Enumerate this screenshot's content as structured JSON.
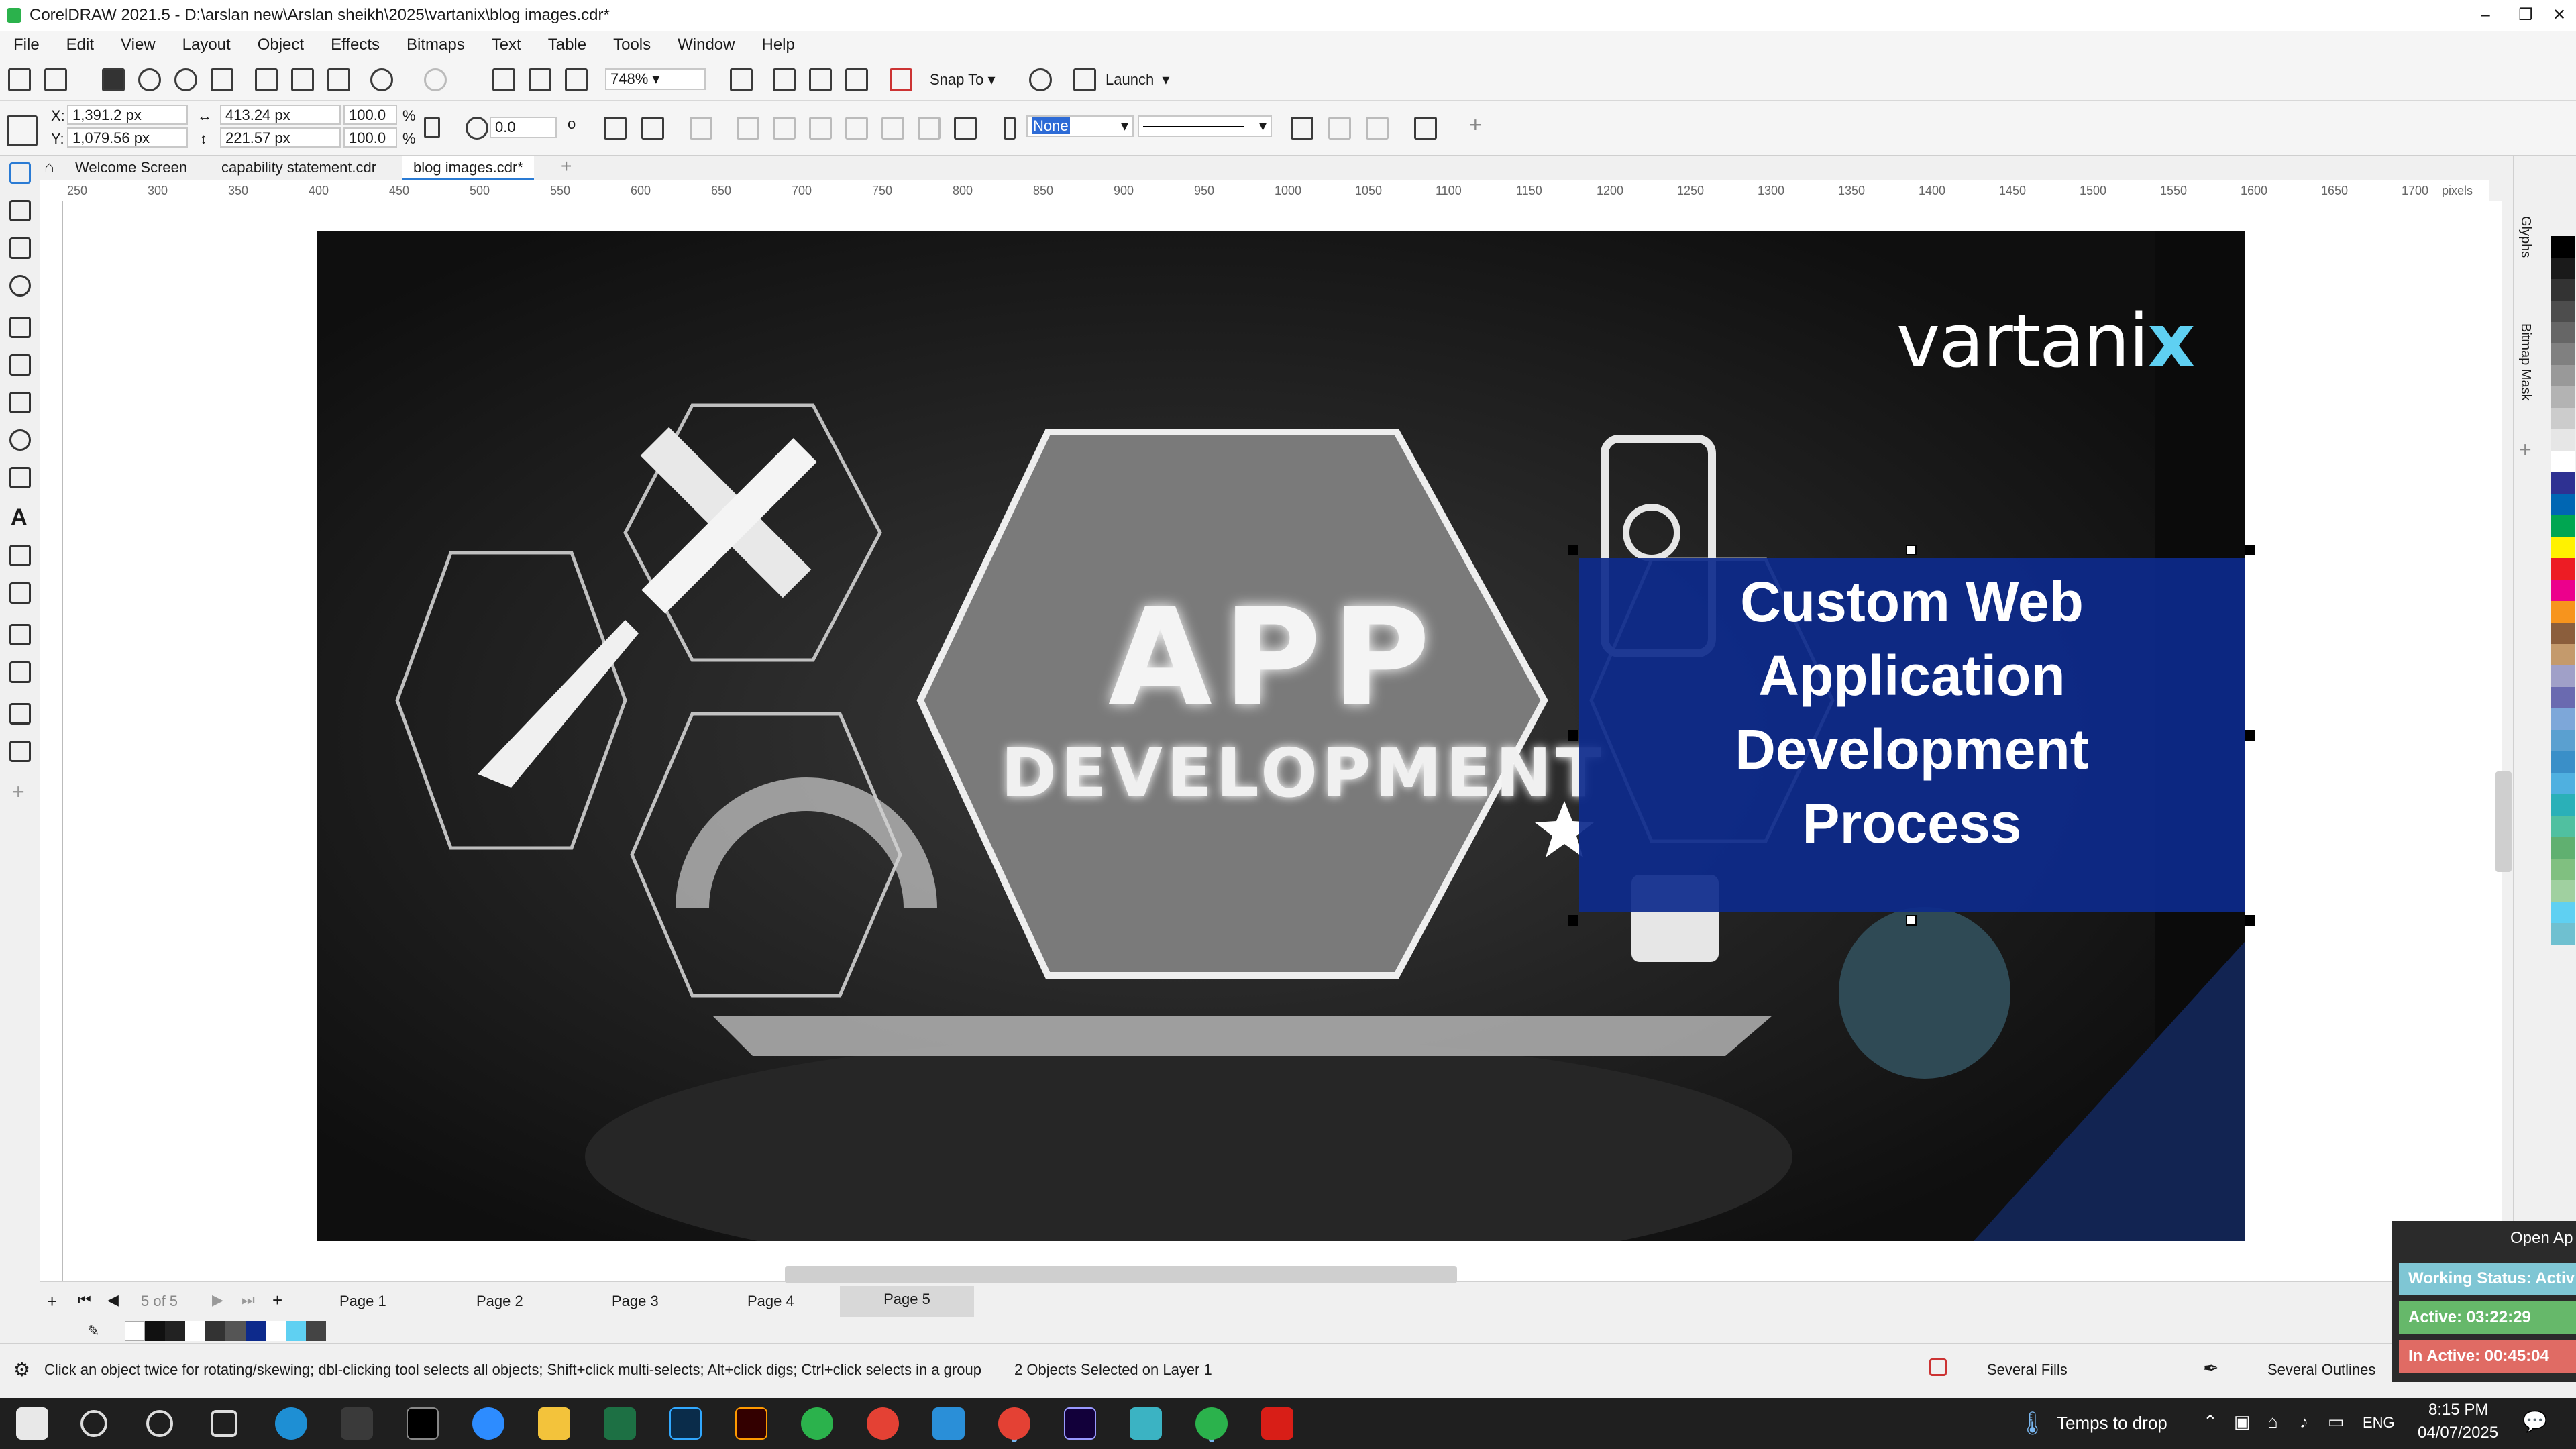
{
  "window": {
    "title": "CorelDRAW 2021.5 - D:\\arslan new\\Arslan sheikh\\2025\\vartanix\\blog images.cdr*"
  },
  "menu": [
    "File",
    "Edit",
    "View",
    "Layout",
    "Object",
    "Effects",
    "Bitmaps",
    "Text",
    "Table",
    "Tools",
    "Window",
    "Help"
  ],
  "toolbar": {
    "zoom": "748%",
    "snap_to": "Snap To",
    "launch": "Launch"
  },
  "property_bar": {
    "x": "1,391.2 px",
    "y": "1,079.56 px",
    "width": "413.24 px",
    "height": "221.57 px",
    "scale_w": "100.0",
    "scale_h": "100.0",
    "percent": "%",
    "rotation": "0.0",
    "outline": "None"
  },
  "doc_tabs": [
    "Welcome Screen",
    "capability statement.cdr",
    "blog images.cdr*"
  ],
  "ruler_labels": [
    "250",
    "300",
    "350",
    "400",
    "450",
    "500",
    "550",
    "600",
    "650",
    "700",
    "750",
    "800",
    "850",
    "900",
    "950",
    "1000",
    "1050",
    "1100",
    "1150",
    "1200",
    "1250",
    "1300",
    "1350",
    "1400",
    "1450",
    "1500",
    "1550",
    "1600",
    "1650",
    "1700"
  ],
  "ruler_unit": "pixels",
  "right_dock": {
    "glyphs": "Glyphs",
    "bitmap_mask": "Bitmap Mask"
  },
  "artwork": {
    "brand": "vartani",
    "brand_x": "x",
    "headline": [
      "Custom Web",
      "Application",
      "Development",
      "Process"
    ],
    "app_text": "APP",
    "dev_text": "DEVELOPMENT",
    "colors": {
      "blue_panel": "#0d2a8c",
      "teal_circle": "#2f4a55",
      "accent_cyan": "#5fd0f2"
    }
  },
  "pages": {
    "counter": "5 of 5",
    "tabs": [
      "Page 1",
      "Page 2",
      "Page 3",
      "Page 4",
      "Page 5"
    ],
    "active": "Page 5"
  },
  "status": {
    "hint": "Click an object twice for rotating/skewing; dbl-clicking tool selects all objects; Shift+click multi-selects; Alt+click digs; Ctrl+click selects in a group",
    "selection": "2 Objects Selected on Layer 1",
    "fills": "Several Fills",
    "outlines": "Several Outlines"
  },
  "tracker": {
    "open": "Open Ap",
    "working": "Working Status: Activ",
    "active": "Active: 03:22:29",
    "inactive": "In Active: 00:45:04"
  },
  "taskbar": {
    "weather": "Temps to drop",
    "lang": "ENG",
    "time": "8:15 PM",
    "date": "04/07/2025"
  }
}
